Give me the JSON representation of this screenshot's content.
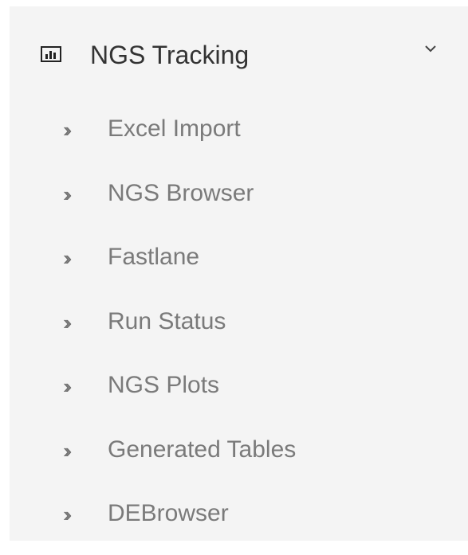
{
  "menu": {
    "title": "NGS Tracking",
    "icon": "bar-chart-icon",
    "toggle_icon": "chevron-down-icon",
    "expanded": true,
    "item_icon": "double-chevron-right-icon",
    "items": [
      {
        "label": "Excel Import"
      },
      {
        "label": "NGS Browser"
      },
      {
        "label": "Fastlane"
      },
      {
        "label": "Run Status"
      },
      {
        "label": "NGS Plots"
      },
      {
        "label": "Generated Tables"
      },
      {
        "label": "DEBrowser"
      }
    ]
  },
  "colors": {
    "sidebar_background": "#f4f4f4",
    "header_text": "#333333",
    "item_text": "#7a7a7a",
    "item_icon": "#707070"
  }
}
